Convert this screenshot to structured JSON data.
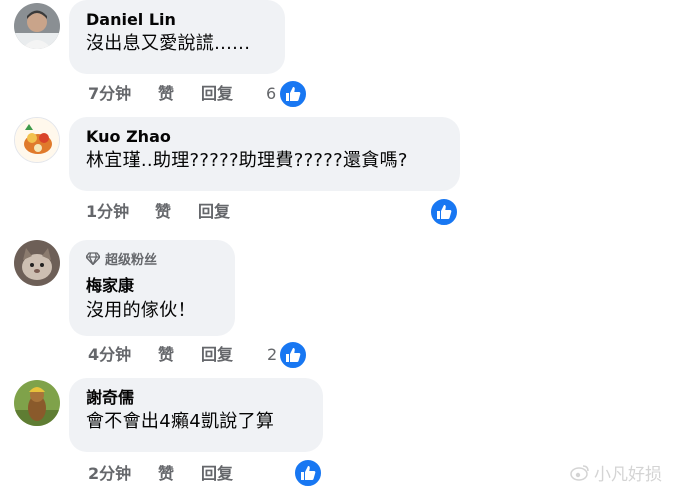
{
  "comments": [
    {
      "author": "Daniel Lin",
      "text": "沒出息又愛說謊......",
      "time": "7分钟",
      "like_label": "赞",
      "reply_label": "回复",
      "like_count": "6"
    },
    {
      "author": "Kuo Zhao",
      "text": "林宜瑾..助理?????助理費?????還貪嗎?",
      "time": "1分钟",
      "like_label": "赞",
      "reply_label": "回复",
      "like_count": ""
    },
    {
      "badge": "超级粉丝",
      "author": "梅家康",
      "text": "沒用的傢伙！",
      "time": "4分钟",
      "like_label": "赞",
      "reply_label": "回复",
      "like_count": "2"
    },
    {
      "author": "謝奇儒",
      "text": "會不會出4癩4凱說了算",
      "time": "2分钟",
      "like_label": "赞",
      "reply_label": "回复",
      "like_count": ""
    }
  ],
  "watermark": "小凡好损",
  "colors": {
    "bubble": "#f0f2f5",
    "like_blue": "#1877f2",
    "meta_gray": "#65676b"
  }
}
